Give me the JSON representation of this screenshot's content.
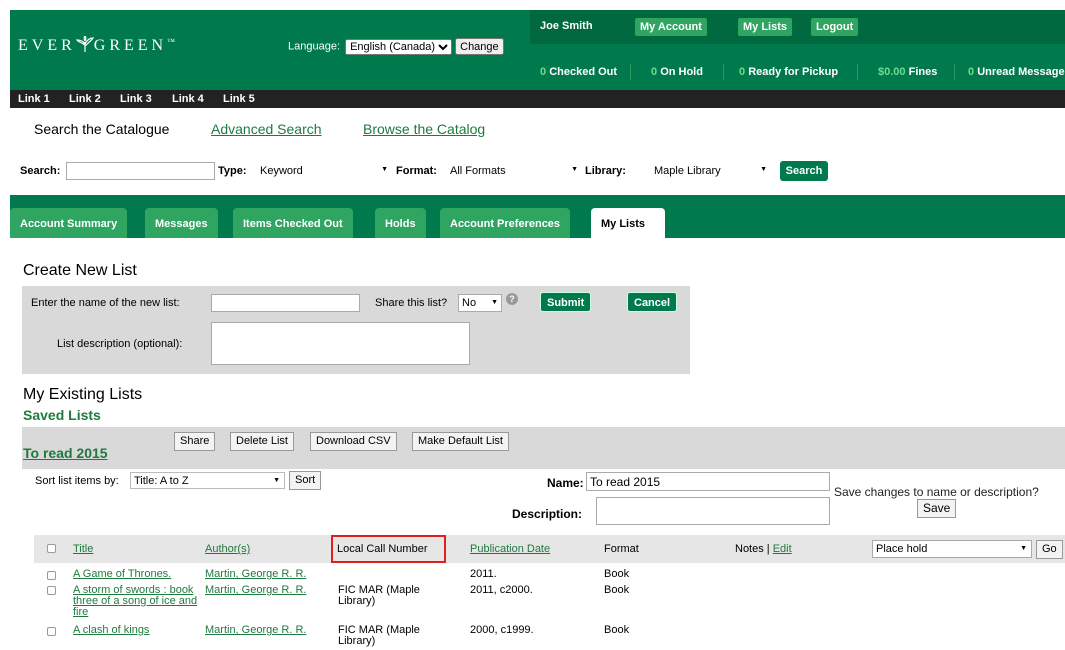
{
  "header": {
    "logo": "EVER🌾GREEN",
    "logo_left": "EVER",
    "logo_right": "GREEN",
    "language_label": "Language:",
    "language_value": "English (Canada)",
    "change_label": "Change",
    "user_name": "Joe Smith",
    "my_account": "My Account",
    "my_lists": "My Lists",
    "logout": "Logout",
    "status": [
      {
        "count": "0",
        "label": "Checked Out"
      },
      {
        "count": "0",
        "label": "On Hold"
      },
      {
        "count": "0",
        "label": "Ready for Pickup"
      },
      {
        "count": "$0.00",
        "label": "Fines"
      },
      {
        "count": "0",
        "label": "Unread Messages"
      }
    ]
  },
  "links": [
    "Link 1",
    "Link 2",
    "Link 3",
    "Link 4",
    "Link 5"
  ],
  "nav": {
    "search_catalogue": "Search the Catalogue",
    "advanced_search": "Advanced Search",
    "browse": "Browse the Catalog"
  },
  "search": {
    "search_label": "Search:",
    "type_label": "Type:",
    "type_value": "Keyword",
    "format_label": "Format:",
    "format_value": "All Formats",
    "library_label": "Library:",
    "library_value": "Maple Library",
    "button": "Search"
  },
  "tabs": [
    "Account Summary",
    "Messages",
    "Items Checked Out",
    "Holds",
    "Account Preferences",
    "My Lists"
  ],
  "create": {
    "title": "Create New List",
    "name_label": "Enter the name of the new list:",
    "share_label": "Share this list?",
    "share_value": "No",
    "submit": "Submit",
    "cancel": "Cancel",
    "desc_label": "List description (optional):"
  },
  "existing": {
    "title": "My Existing Lists",
    "saved": "Saved Lists",
    "list_name": "To read 2015",
    "buttons": [
      "Share",
      "Delete List",
      "Download CSV",
      "Make Default List"
    ],
    "sort_label": "Sort list items by:",
    "sort_value": "Title: A to Z",
    "sort_button": "Sort",
    "name_label": "Name:",
    "name_value": "To read 2015",
    "desc_label": "Description:",
    "save_hint": "Save changes to name or description?",
    "save_button": "Save"
  },
  "table": {
    "headers": {
      "title": "Title",
      "author": "Author(s)",
      "call": "Local Call Number",
      "pubdate": "Publication Date",
      "format": "Format",
      "notes": "Notes | ",
      "edit": "Edit",
      "action": "Place hold",
      "go": "Go"
    },
    "rows": [
      {
        "title": "A Game of Thrones.",
        "author": "Martin, George R. R.",
        "call": "",
        "date": "2011.",
        "format": "Book"
      },
      {
        "title": "A storm of swords : book three of a song of ice and fire",
        "author": "Martin, George R. R.",
        "call": "FIC MAR (Maple Library)",
        "date": "2011, c2000.",
        "format": "Book"
      },
      {
        "title": "A clash of kings",
        "author": "Martin, George R. R.",
        "call": "FIC MAR (Maple Library)",
        "date": "2000, c1999.",
        "format": "Book"
      }
    ]
  }
}
